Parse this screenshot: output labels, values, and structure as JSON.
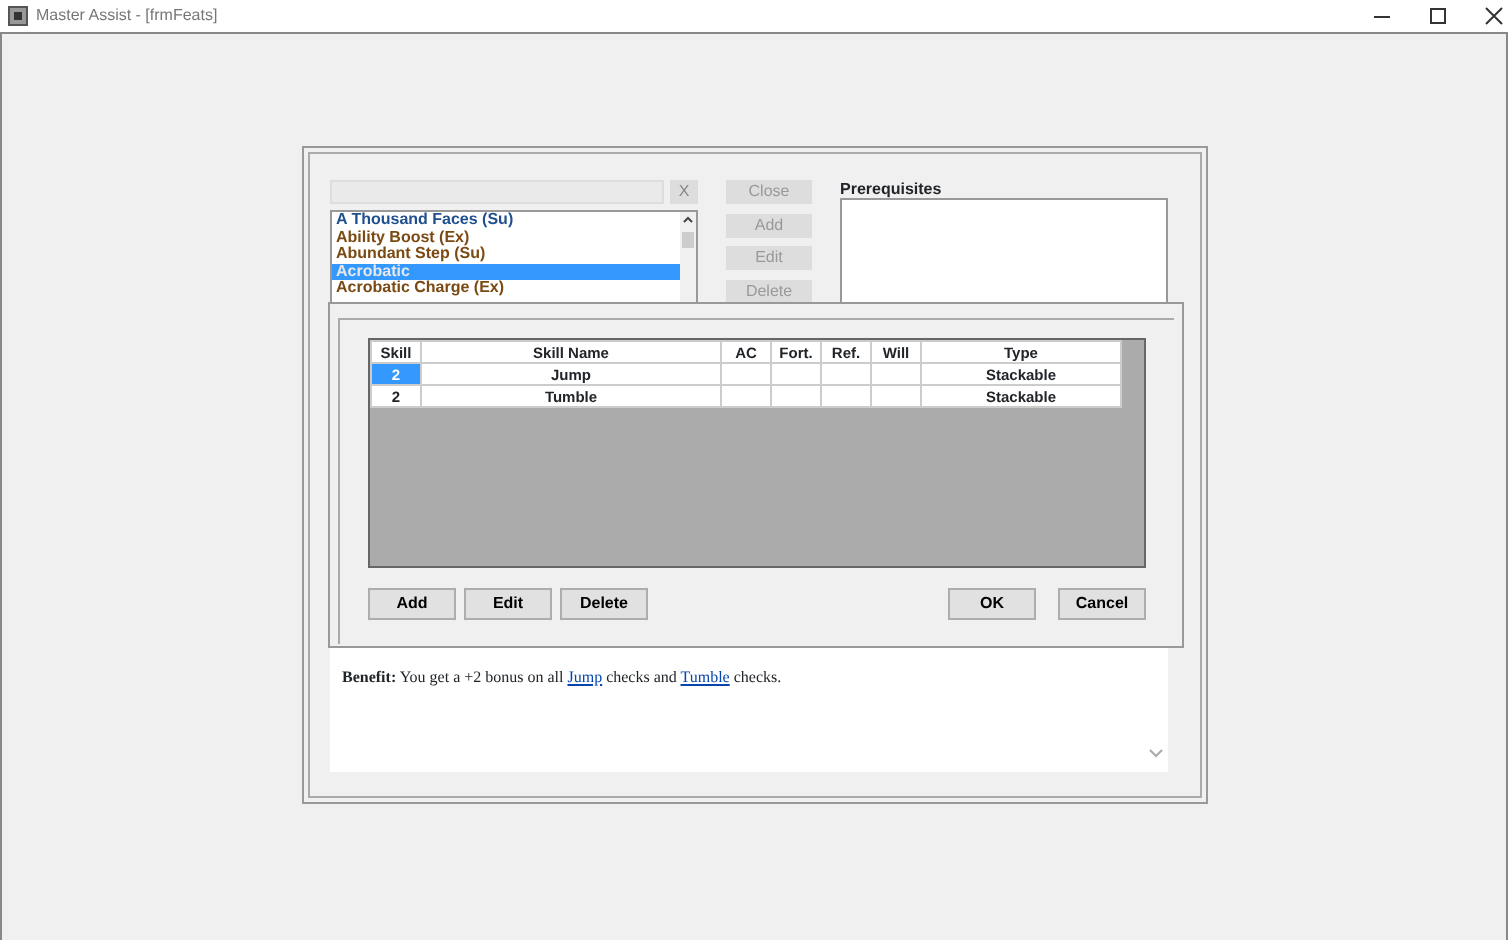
{
  "window": {
    "title": "Master Assist - [frmFeats]"
  },
  "feat_list": [
    {
      "label": "A Thousand Faces (Su)",
      "selected": false,
      "color": "#1f4f8f"
    },
    {
      "label": "Ability Boost (Ex)",
      "selected": false,
      "color": "#7a4a12"
    },
    {
      "label": "Abundant Step (Su)",
      "selected": false,
      "color": "#7a4a12"
    },
    {
      "label": "Acrobatic",
      "selected": true
    },
    {
      "label": "Acrobatic Charge (Ex)",
      "selected": false,
      "color": "#7a4a12"
    }
  ],
  "clear_button": "X",
  "side_buttons": [
    {
      "label": "Close",
      "disabled": true
    },
    {
      "label": "Add",
      "disabled": true
    },
    {
      "label": "Edit",
      "disabled": true
    },
    {
      "label": "Delete",
      "disabled": true
    }
  ],
  "prerequisites": {
    "label": "Prerequisites"
  },
  "skill_dialog": {
    "columns": [
      "Skill",
      "Skill Name",
      "AC",
      "Fort.",
      "Ref.",
      "Will",
      "Type"
    ],
    "rows": [
      {
        "selected": true,
        "cells": [
          "2",
          "Jump",
          "",
          "",
          "",
          "",
          "Stackable"
        ]
      },
      {
        "selected": false,
        "cells": [
          "2",
          "Tumble",
          "",
          "",
          "",
          "",
          "Stackable"
        ]
      }
    ],
    "left_buttons": [
      "Add",
      "Edit",
      "Delete"
    ],
    "right_buttons": [
      "OK",
      "Cancel"
    ]
  },
  "benefit": {
    "label": "Benefit:",
    "parts": [
      {
        "kind": "text",
        "text": " You get a +2 bonus on all "
      },
      {
        "kind": "link",
        "text": "Jump"
      },
      {
        "kind": "text",
        "text": " checks and "
      },
      {
        "kind": "link",
        "text": "Tumble"
      },
      {
        "kind": "text",
        "text": " checks."
      }
    ]
  }
}
